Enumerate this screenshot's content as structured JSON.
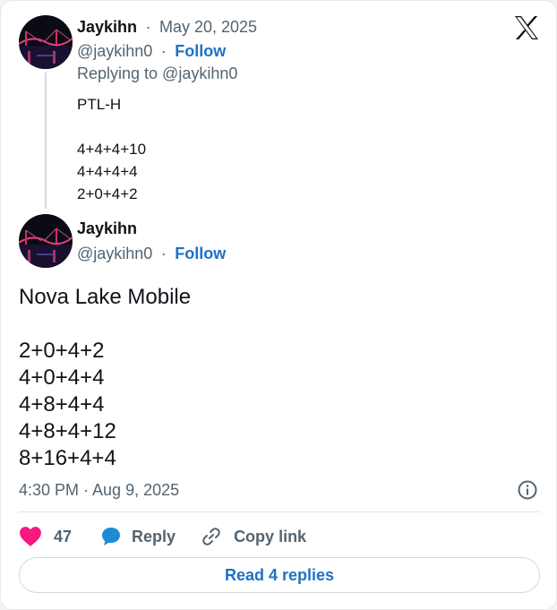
{
  "parent_tweet": {
    "author_name": "Jaykihn",
    "separator": "·",
    "date": "May 20, 2025",
    "handle": "@jaykihn0",
    "follow_label": "Follow",
    "replying_to": "Replying to @jaykihn0",
    "lines": [
      "PTL-H",
      "",
      "4+4+4+10",
      "4+4+4+4",
      "2+0+4+2"
    ]
  },
  "main_tweet": {
    "author_name": "Jaykihn",
    "handle": "@jaykihn0",
    "separator": "·",
    "follow_label": "Follow",
    "lines": [
      "Nova Lake Mobile",
      "",
      "2+0+4+2",
      "4+0+4+4",
      "4+8+4+4",
      "4+8+4+12",
      "8+16+4+4"
    ],
    "timestamp": "4:30 PM · Aug 9, 2025"
  },
  "actions": {
    "like_count": "47",
    "reply_label": "Reply",
    "copy_link_label": "Copy link"
  },
  "read_replies_label": "Read 4 replies",
  "icons": {
    "brand": "x-logo-icon",
    "like": "heart-icon",
    "reply": "speech-bubble-icon",
    "copy": "link-icon",
    "info": "info-icon"
  },
  "colors": {
    "accent": "#1d72c4",
    "like": "#f91880",
    "muted": "#536471",
    "thread_line": "#cfd9de"
  }
}
